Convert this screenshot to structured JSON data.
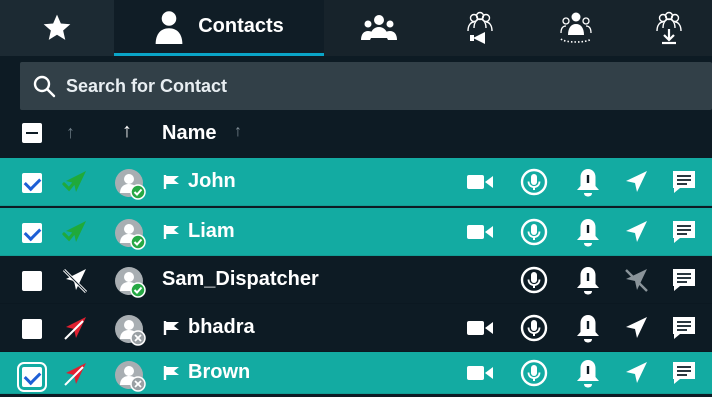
{
  "tabs": [
    {
      "icon": "star-icon",
      "label": ""
    },
    {
      "icon": "contact-person-icon",
      "label": "Contacts"
    },
    {
      "icon": "group-icon",
      "label": ""
    },
    {
      "icon": "broadcast-group-icon",
      "label": ""
    },
    {
      "icon": "dispatch-group-icon",
      "label": ""
    },
    {
      "icon": "download-group-icon",
      "label": ""
    }
  ],
  "active_tab": "Contacts",
  "search": {
    "placeholder": "Search for Contact",
    "value": ""
  },
  "header": {
    "name_label": "Name",
    "sort_icons": [
      "sort-arrow-up-icon",
      "sort-arrow-up-icon",
      "sort-arrow-up-icon"
    ]
  },
  "contacts": [
    {
      "name": "John",
      "checked": true,
      "selected": true,
      "status": "online-check",
      "presence": "available",
      "video": true
    },
    {
      "name": "Liam",
      "checked": true,
      "selected": true,
      "status": "online-check",
      "presence": "available",
      "video": true
    },
    {
      "name": "Sam_Dispatcher",
      "checked": false,
      "selected": false,
      "status": "location-disabled",
      "presence": "available",
      "video": false
    },
    {
      "name": "bhadra",
      "checked": false,
      "selected": false,
      "status": "location-error",
      "presence": "offline",
      "video": true
    },
    {
      "name": "Brown",
      "checked": true,
      "selected": true,
      "status": "location-error",
      "presence": "offline",
      "video": true
    }
  ],
  "colors": {
    "background": "#0d1b24",
    "selected_row": "#13aba2",
    "tab_accent": "#0aa5c8",
    "search_bg": "#324048",
    "status_green": "#1faa3a",
    "status_red": "#e02030",
    "presence_green": "#26a844",
    "presence_gray": "#9aa0a4"
  }
}
